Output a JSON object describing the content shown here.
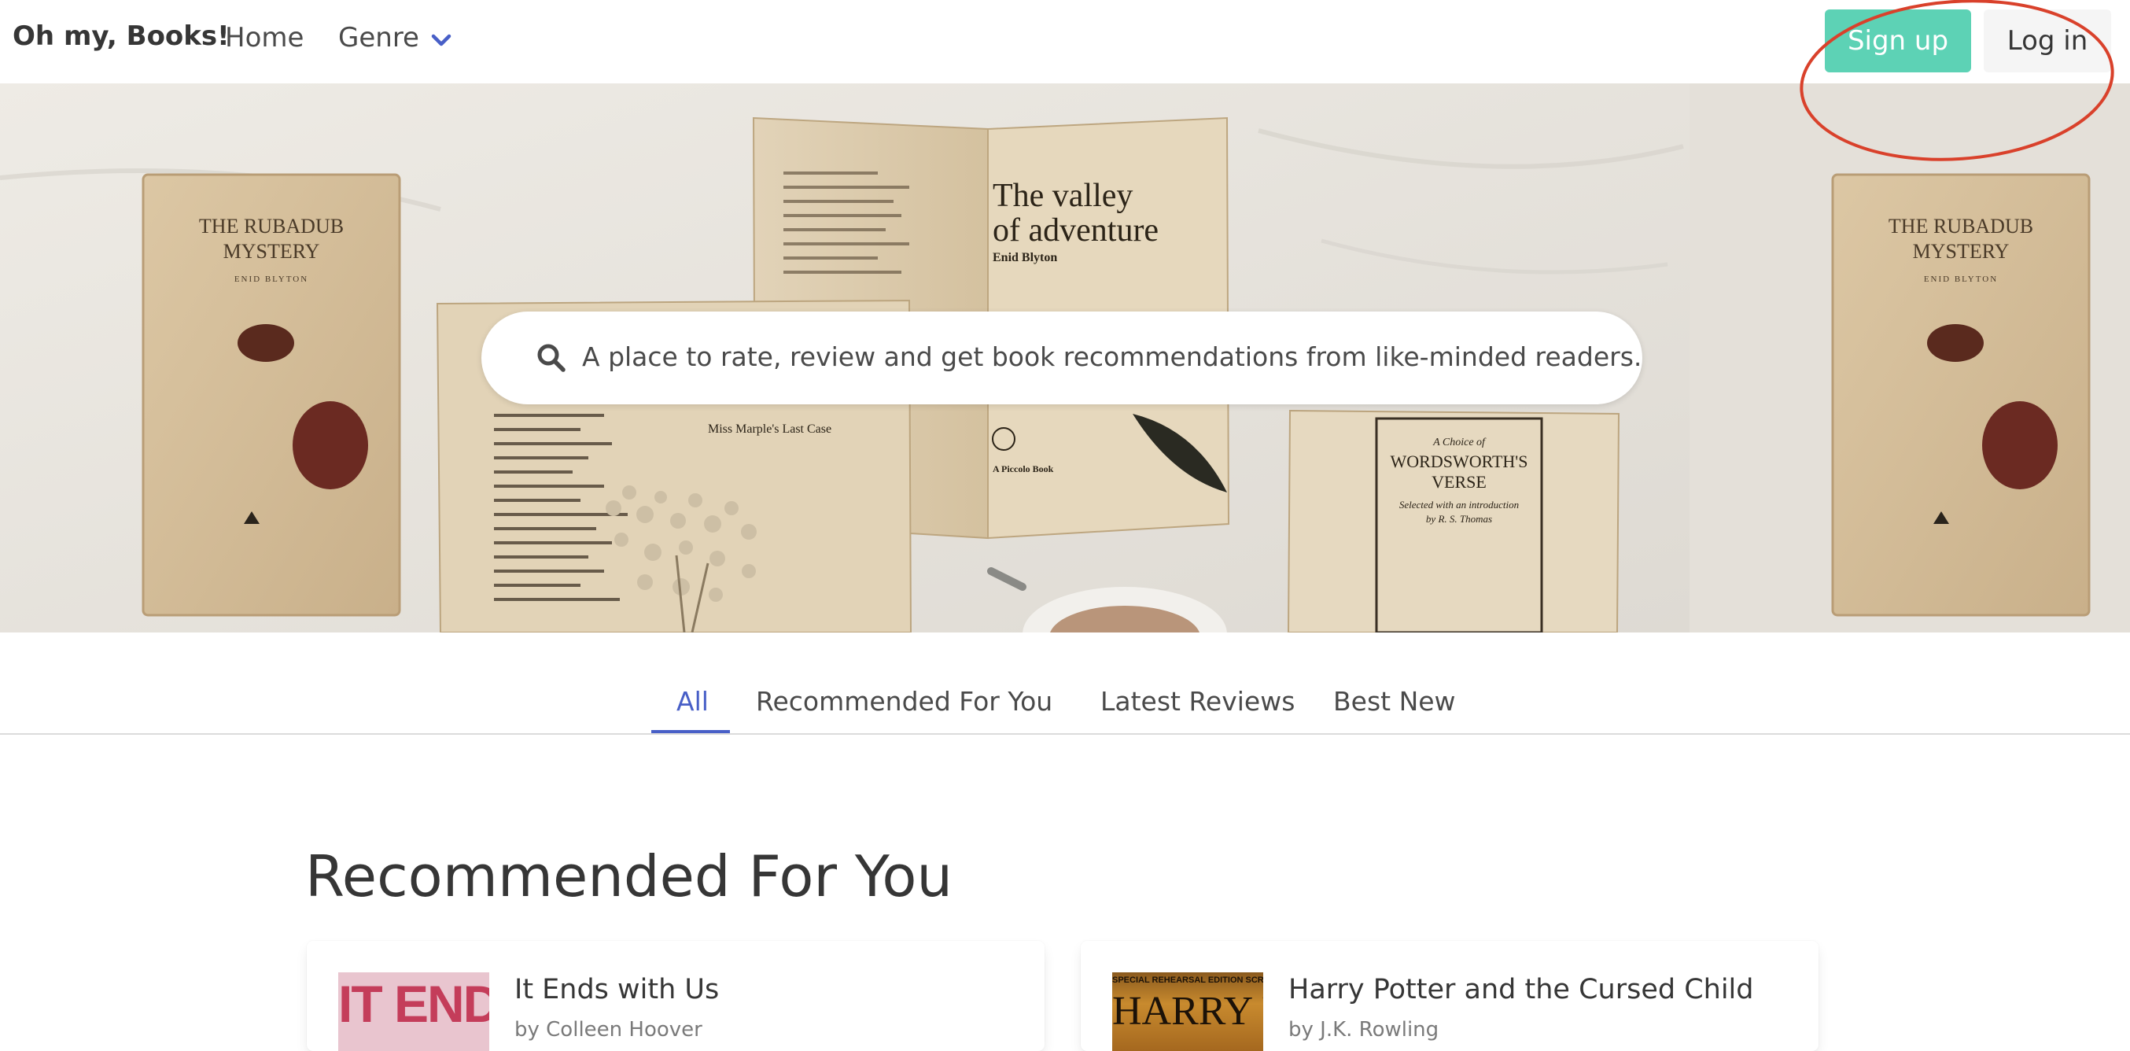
{
  "nav": {
    "brand": "Oh my, Books!",
    "home": "Home",
    "genre": "Genre",
    "signup": "Sign up",
    "login": "Log in"
  },
  "hero": {
    "search_text": "A place to rate, review and get book recommendations from like-minded readers.",
    "book_left": {
      "title_line1": "THE RUBADUB",
      "title_line2": "MYSTERY",
      "author": "ENID BLYTON"
    },
    "book_right": {
      "title_line1": "THE RUBADUB",
      "title_line2": "MYSTERY",
      "author": "ENID BLYTON"
    },
    "book_center": {
      "title_line1": "The valley",
      "title_line2": "of adventure",
      "author": "Enid Blyton"
    },
    "book_lower_left": {
      "subtitle": "Miss Marple's Last Case"
    },
    "book_lower_right": {
      "line1": "A Choice of",
      "line2": "WORDSWORTH'S",
      "line3": "VERSE",
      "line4": "Selected with an introduction",
      "line5": "by R. S. Thomas"
    },
    "book_center_footer": "A Piccolo Book"
  },
  "tabs": [
    {
      "label": "All",
      "active": true
    },
    {
      "label": "Recommended For You",
      "active": false
    },
    {
      "label": "Latest Reviews",
      "active": false
    },
    {
      "label": "Best New",
      "active": false
    }
  ],
  "section": {
    "title": "Recommended For You"
  },
  "books": [
    {
      "title": "It Ends with Us",
      "author": "by Colleen Hoover",
      "cover_text": "IT ENDS"
    },
    {
      "title": "Harry Potter and the Cursed Child",
      "author": "by J.K. Rowling",
      "cover_subtitle": "SPECIAL REHEARSAL EDITION SCRIPT",
      "cover_text": "HARRY POTTER"
    }
  ],
  "colors": {
    "accent": "#485fc7",
    "signup_bg": "#5dd2b5",
    "login_bg": "#f5f5f5",
    "annotation": "#d9412b"
  },
  "icons": {
    "genre_dropdown": "chevron-down-icon",
    "search": "search-icon"
  }
}
